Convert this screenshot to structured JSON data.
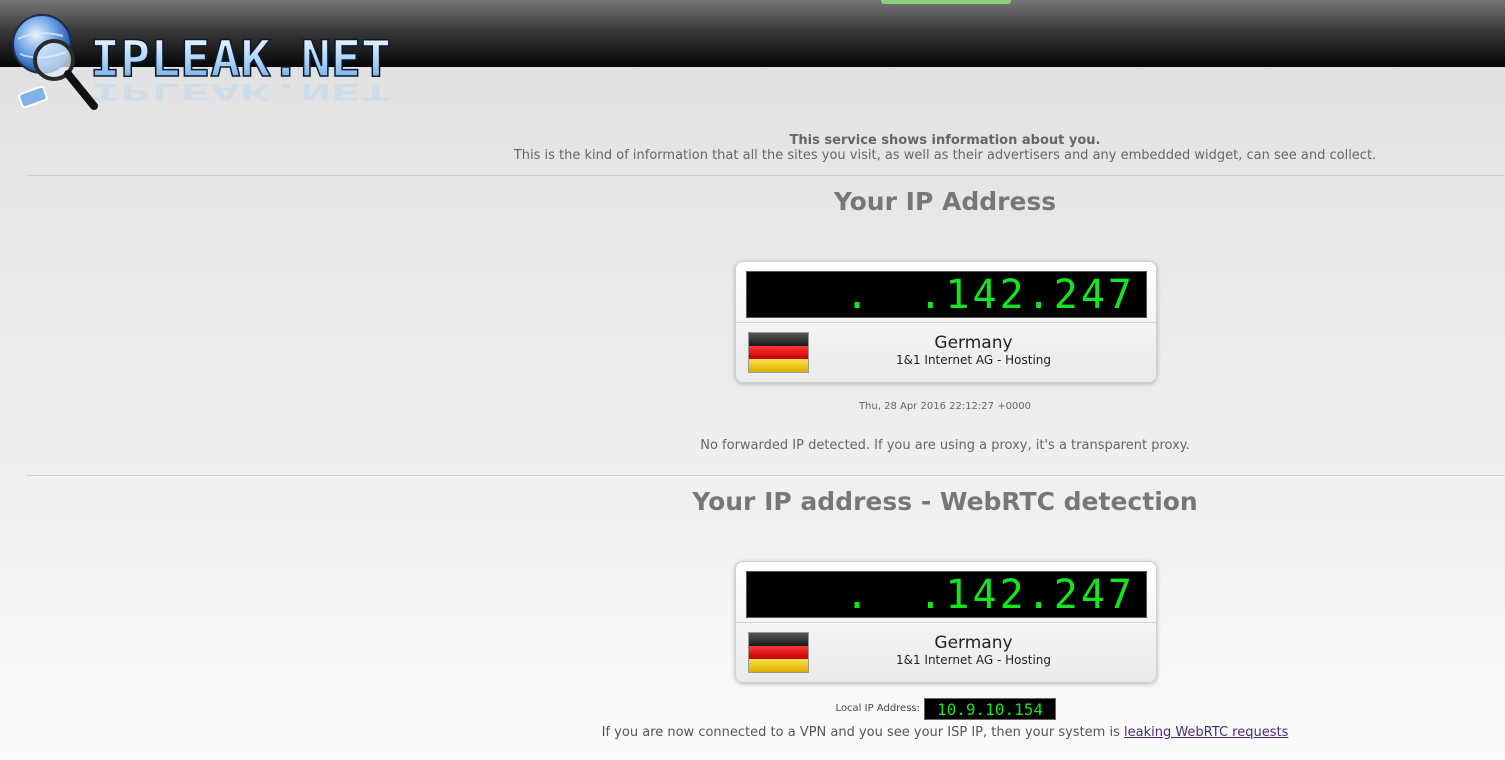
{
  "header": {
    "logo_text": "IPLEAK.NET",
    "accent_color": "#8ed07a"
  },
  "intro": {
    "title": "This service shows information about you.",
    "text": "This is the kind of information that all the sites you visit, as well as their advertisers and any embedded widget, can see and collect."
  },
  "ip_section": {
    "title": "Your IP Address",
    "ip_visible": ".142.247",
    "country": "Germany",
    "flag_icon": "germany-flag-icon",
    "isp": "1&1 Internet AG - Hosting",
    "timestamp": "Thu, 28 Apr 2016 22:12:27 +0000",
    "forward_note": "No forwarded IP detected. If you are using a proxy, it's a transparent proxy."
  },
  "webrtc_section": {
    "title": "Your IP address - WebRTC detection",
    "ip_visible": ".142.247",
    "country": "Germany",
    "flag_icon": "germany-flag-icon",
    "isp": "1&1 Internet AG - Hosting",
    "local_ip_label": "Local IP Address:",
    "local_ip": "10.9.10.154",
    "vpn_note_prefix": "If you are now connected to a VPN and you see your ISP IP, then your system is",
    "vpn_note_link": "leaking WebRTC requests"
  },
  "colors": {
    "led_green": "#12e61e",
    "flag_black": "#1c1c1c",
    "flag_red": "#dd0000",
    "flag_gold": "#ffce00"
  }
}
